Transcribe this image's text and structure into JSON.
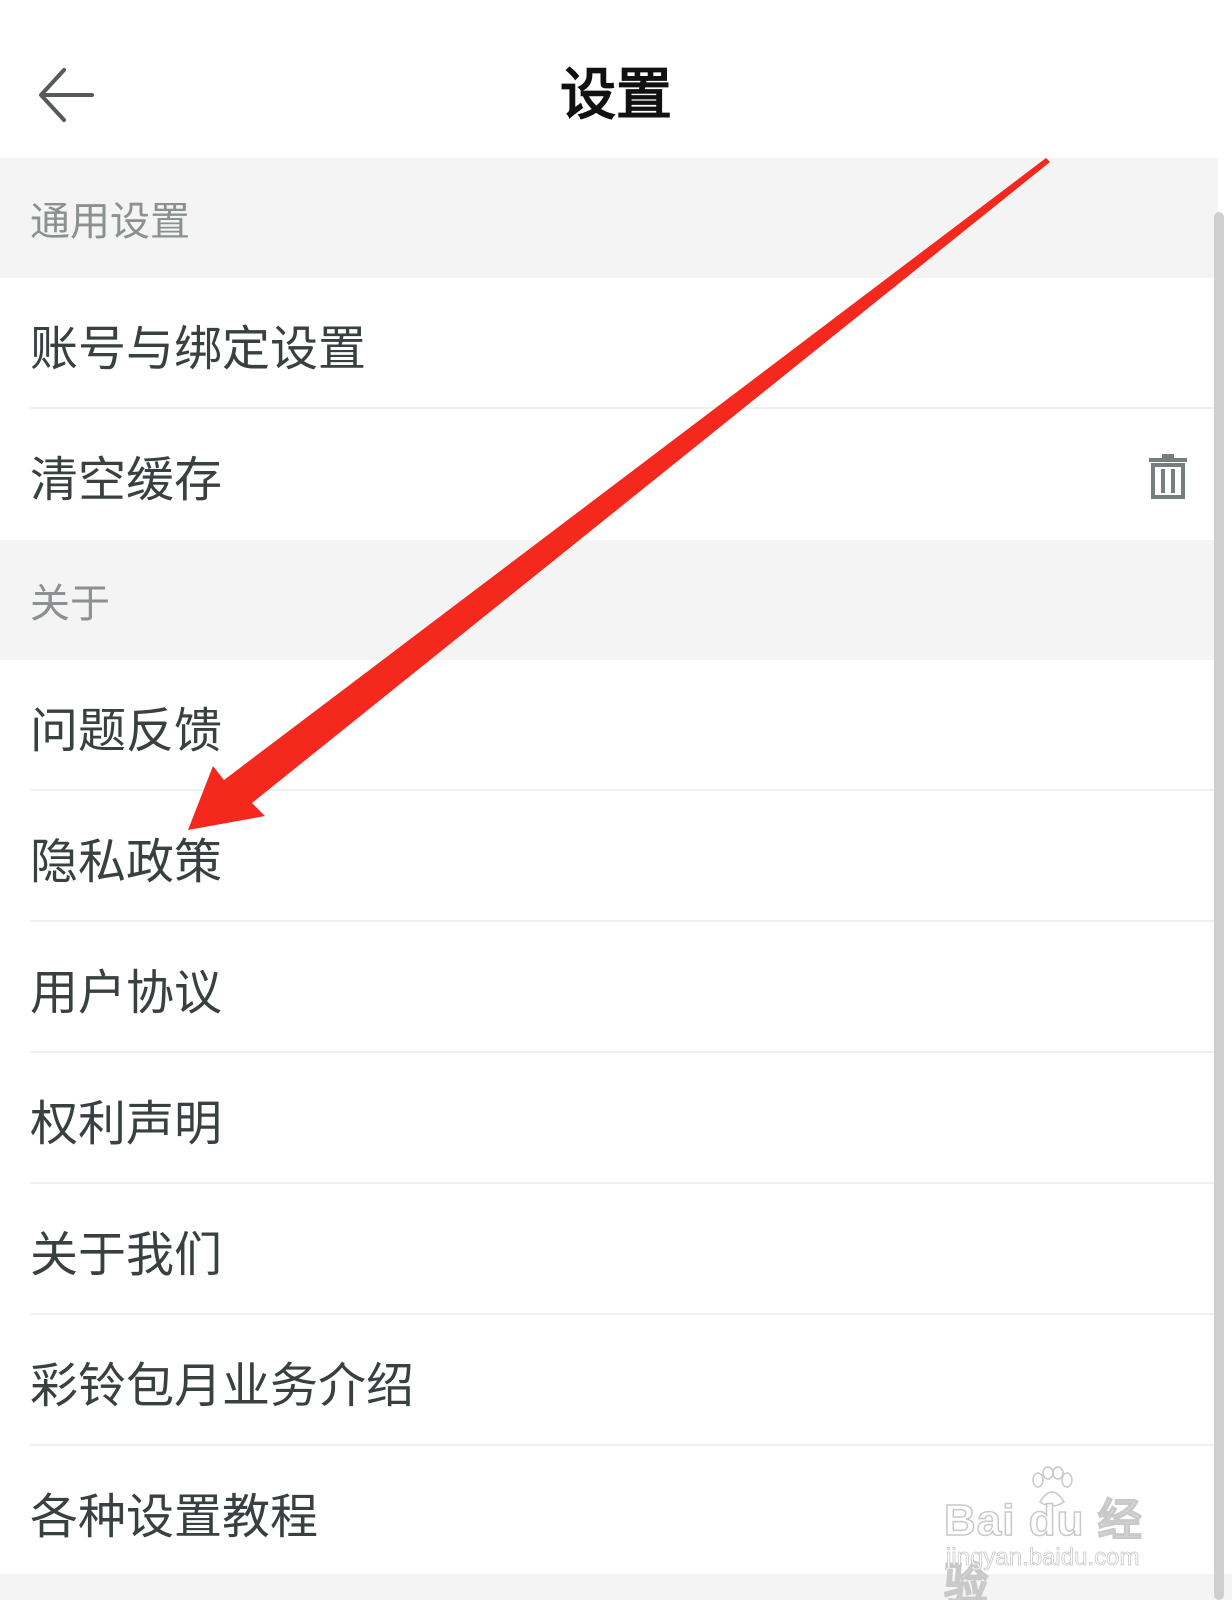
{
  "header": {
    "back_icon": "arrow-left-icon",
    "title": "设置"
  },
  "sections": {
    "general": {
      "title": "通用设置",
      "items": [
        {
          "label": "账号与绑定设置"
        },
        {
          "label": "清空缓存",
          "icon": "trash-icon"
        }
      ]
    },
    "about": {
      "title": "关于",
      "items": [
        {
          "label": "问题反馈"
        },
        {
          "label": "隐私政策"
        },
        {
          "label": "用户协议"
        },
        {
          "label": "权利声明"
        },
        {
          "label": "关于我们"
        },
        {
          "label": "彩铃包月业务介绍"
        },
        {
          "label": "各种设置教程"
        }
      ]
    }
  },
  "annotation": {
    "arrow_color": "#f5281e",
    "points_to": "隐私政策"
  },
  "watermark": {
    "brand": "Bai du 经验",
    "url": "jingyan.baidu.com"
  },
  "colors": {
    "section_bg": "#f4f4f4",
    "section_text": "#8b9090",
    "item_text": "#384040",
    "title_text": "#111111"
  }
}
